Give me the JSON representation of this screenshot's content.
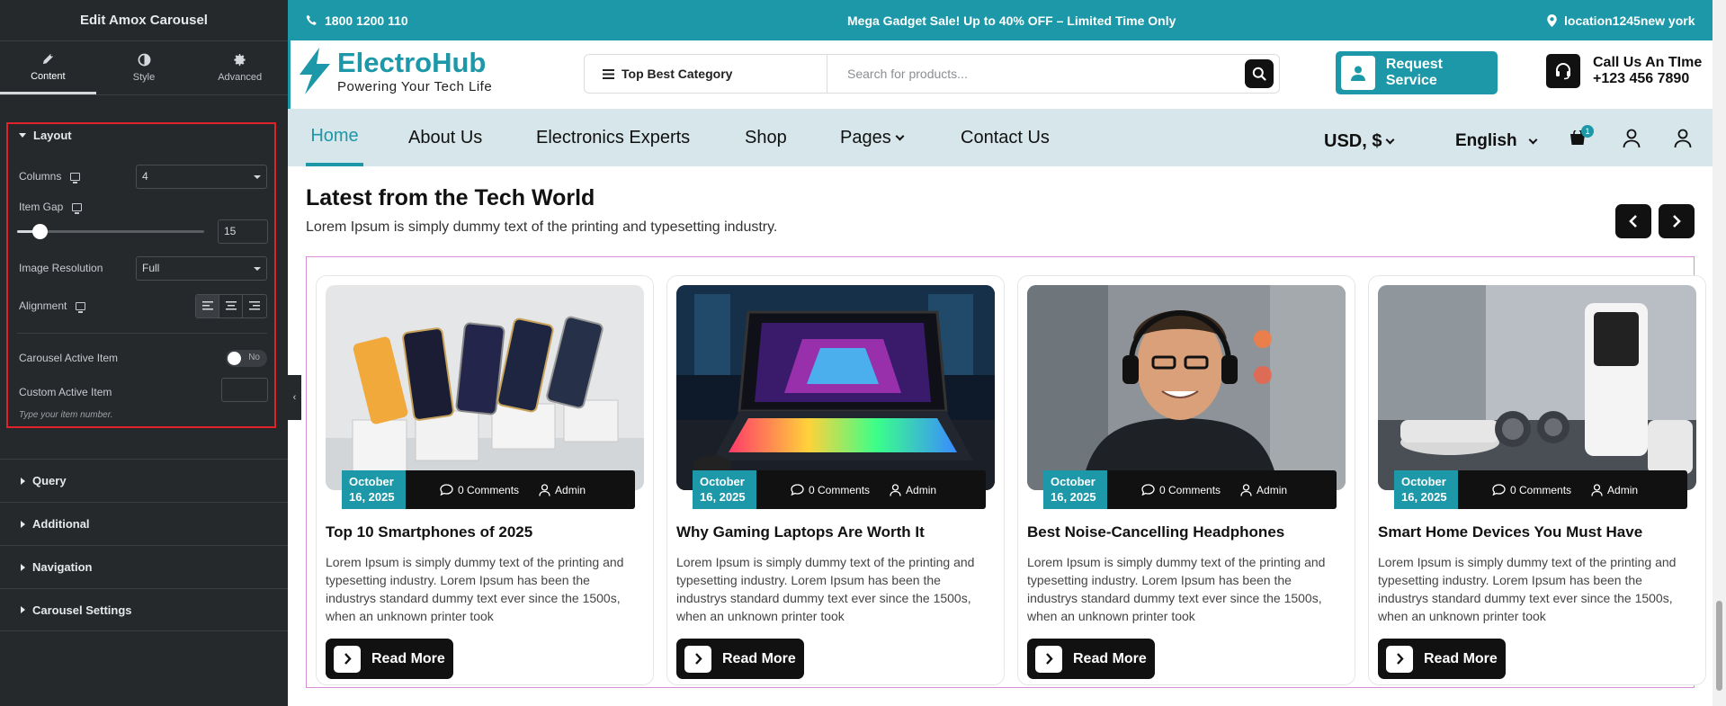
{
  "editor": {
    "title": "Edit Amox Carousel",
    "tabs": [
      {
        "label": "Content",
        "icon": "pencil-icon",
        "active": true
      },
      {
        "label": "Style",
        "icon": "half-circle-icon",
        "active": false
      },
      {
        "label": "Advanced",
        "icon": "gear-icon",
        "active": false
      }
    ],
    "layout": {
      "heading": "Layout",
      "columns_label": "Columns",
      "columns_value": "4",
      "item_gap_label": "Item Gap",
      "item_gap_value": "15",
      "item_gap_fraction": 0.12,
      "image_resolution_label": "Image Resolution",
      "image_resolution_value": "Full",
      "alignment_label": "Alignment",
      "alignment_active": "left",
      "carousel_active_label": "Carousel Active Item",
      "carousel_active_toggle": "No",
      "custom_active_label": "Custom Active Item",
      "custom_active_value": "",
      "custom_active_hint": "Type your item number."
    },
    "sections": [
      "Query",
      "Additional",
      "Navigation",
      "Carousel Settings"
    ]
  },
  "topbar": {
    "phone": "1800 1200 110",
    "promo": "Mega Gadget Sale! Up to 40% OFF – Limited Time Only",
    "location": "location1245new york"
  },
  "header": {
    "logo_name": "ElectroHub",
    "logo_tagline": "Powering Your Tech Life",
    "category_label": "Top Best Category",
    "search_placeholder": "Search for products...",
    "request_button": "Request Service",
    "call_line1": "Call Us An TIme",
    "call_line2": "+123 456 7890"
  },
  "nav": {
    "items": [
      "Home",
      "About Us",
      "Electronics Experts",
      "Shop",
      "Pages",
      "Contact Us"
    ],
    "currency": "USD, $",
    "language": "English",
    "cart_count": "1"
  },
  "blog": {
    "title": "Latest from the Tech World",
    "subtitle": "Lorem Ipsum is simply dummy text of the printing and typesetting industry.",
    "read_more": "Read More",
    "posts": [
      {
        "date": "October 16, 2025",
        "comments": "0 Comments",
        "author": "Admin",
        "title": "Top 10 Smartphones of 2025",
        "excerpt": "Lorem Ipsum is simply dummy text of the printing and typesetting industry. Lorem Ipsum has been the industrys standard dummy text ever since the 1500s, when an unknown printer took"
      },
      {
        "date": "October 16, 2025",
        "comments": "0 Comments",
        "author": "Admin",
        "title": "Why Gaming Laptops Are Worth It",
        "excerpt": "Lorem Ipsum is simply dummy text of the printing and typesetting industry. Lorem Ipsum has been the industrys standard dummy text ever since the 1500s, when an unknown printer took"
      },
      {
        "date": "October 16, 2025",
        "comments": "0 Comments",
        "author": "Admin",
        "title": "Best Noise-Cancelling Headphones",
        "excerpt": "Lorem Ipsum is simply dummy text of the printing and typesetting industry. Lorem Ipsum has been the industrys standard dummy text ever since the 1500s, when an unknown printer took"
      },
      {
        "date": "October 16, 2025",
        "comments": "0 Comments",
        "author": "Admin",
        "title": "Smart Home Devices You Must Have",
        "excerpt": "Lorem Ipsum is simply dummy text of the printing and typesetting industry. Lorem Ipsum has been the industrys standard dummy text ever since the 1500s, when an unknown printer took"
      }
    ]
  },
  "colors": {
    "brand": "#1c98a8",
    "editor_bg": "#26292c",
    "nav_bg": "#d6e6ea",
    "highlight": "#e0232b"
  }
}
